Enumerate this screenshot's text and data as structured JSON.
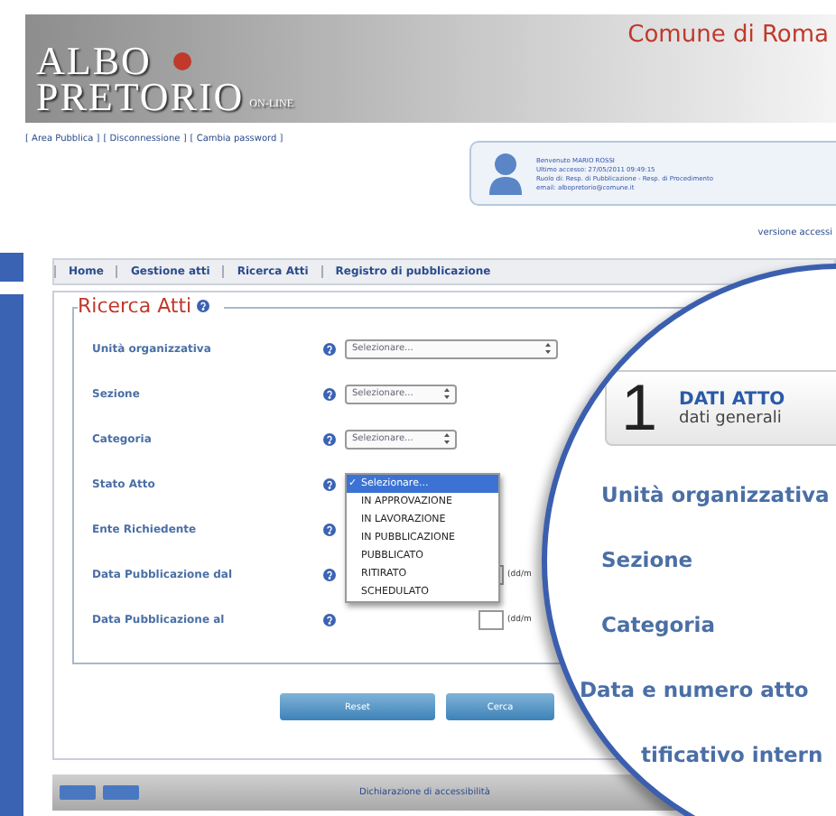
{
  "header": {
    "logo_line1": "ALBO",
    "logo_line2": "PRETORIO",
    "logo_suffix": "ON-LINE",
    "city": "Comune di Roma"
  },
  "top_links": [
    "[ Area Pubblica ]",
    "[ Disconnessione ]",
    "[ Cambia password ]"
  ],
  "user_box": {
    "lines": [
      "Benvenuto MARIO ROSSI",
      "Ultimo accesso: 27/05/2011 09:49:15",
      "Ruolo di: Resp. di Pubblicazione - Resp. di Procedimento",
      "email: albopretorio@comune.it"
    ]
  },
  "accessible_link": "versione accessi",
  "nav_tabs": [
    "Home",
    "Gestione atti",
    "Ricerca Atti",
    "Registro di pubblicazione"
  ],
  "search": {
    "title": "Ricerca Atti",
    "fields": [
      {
        "label": "Unità organizzativa",
        "kind": "select_wide",
        "value": "Selezionare..."
      },
      {
        "label": "Sezione",
        "kind": "select",
        "value": "Selezionare..."
      },
      {
        "label": "Categoria",
        "kind": "select",
        "value": "Selezionare..."
      },
      {
        "label": "Stato Atto",
        "kind": "open_select",
        "check_mark": "✓",
        "options": [
          {
            "label": "Selezionare...",
            "selected": true
          },
          {
            "label": "IN APPROVAZIONE",
            "selected": false
          },
          {
            "label": "IN LAVORAZIONE",
            "selected": false
          },
          {
            "label": "IN PUBBLICAZIONE",
            "selected": false
          },
          {
            "label": "PUBBLICATO",
            "selected": false
          },
          {
            "label": "RITIRATO",
            "selected": false
          },
          {
            "label": "SCHEDULATO",
            "selected": false
          }
        ]
      },
      {
        "label": "Ente Richiedente",
        "kind": "none"
      },
      {
        "label": "Data Pubblicazione dal",
        "kind": "date",
        "hint": "(dd/m"
      },
      {
        "label": "Data Pubblicazione al",
        "kind": "date",
        "hint": "(dd/m"
      }
    ]
  },
  "buttons": [
    "Reset",
    "Cerca"
  ],
  "footer": {
    "link": "Dichiarazione di accessibilità"
  },
  "magnifier": {
    "step_number": "1",
    "step_title": "DATI ATTO",
    "step_subtitle": "dati generali",
    "labels": [
      "Unità organizzativa",
      "Sezione",
      "Categoria",
      "Data e numero atto",
      "tificativo intern"
    ]
  }
}
